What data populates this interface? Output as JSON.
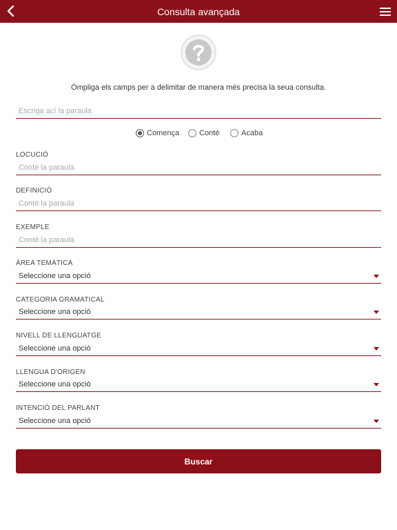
{
  "header": {
    "title": "Consulta avançada",
    "accent_color": "#8c1019",
    "back_icon": "chevron-left-icon",
    "menu_icon": "hamburger-menu-icon"
  },
  "help_icon": "question-mark-icon",
  "intro_text": "Òmpliga els camps per a delimitar de manera més precisa la seua consulta.",
  "search": {
    "placeholder": "Escriga ací la paraula"
  },
  "match_options": [
    {
      "label": "Comença",
      "selected": true
    },
    {
      "label": "Conté",
      "selected": false
    },
    {
      "label": "Acaba",
      "selected": false
    }
  ],
  "text_fields": [
    {
      "label": "LOCUCIÓ",
      "placeholder": "Conté la paraula"
    },
    {
      "label": "DEFINICIÓ",
      "placeholder": "Conté la paraula"
    },
    {
      "label": "EXEMPLE",
      "placeholder": "Conté la paraula"
    }
  ],
  "select_fields": [
    {
      "label": "ÀREA TEMÀTICA",
      "value": "Seleccione una opció"
    },
    {
      "label": "CATEGORIA GRAMATICAL",
      "value": "Seleccione una opció"
    },
    {
      "label": "NIVELL DE LLENGUATGE",
      "value": "Seleccione una opció"
    },
    {
      "label": "LLENGUA D'ORIGEN",
      "value": "Seleccione una opció"
    },
    {
      "label": "INTENCIÓ DEL PARLANT",
      "value": "Seleccione una opció"
    }
  ],
  "submit_label": "Buscar"
}
